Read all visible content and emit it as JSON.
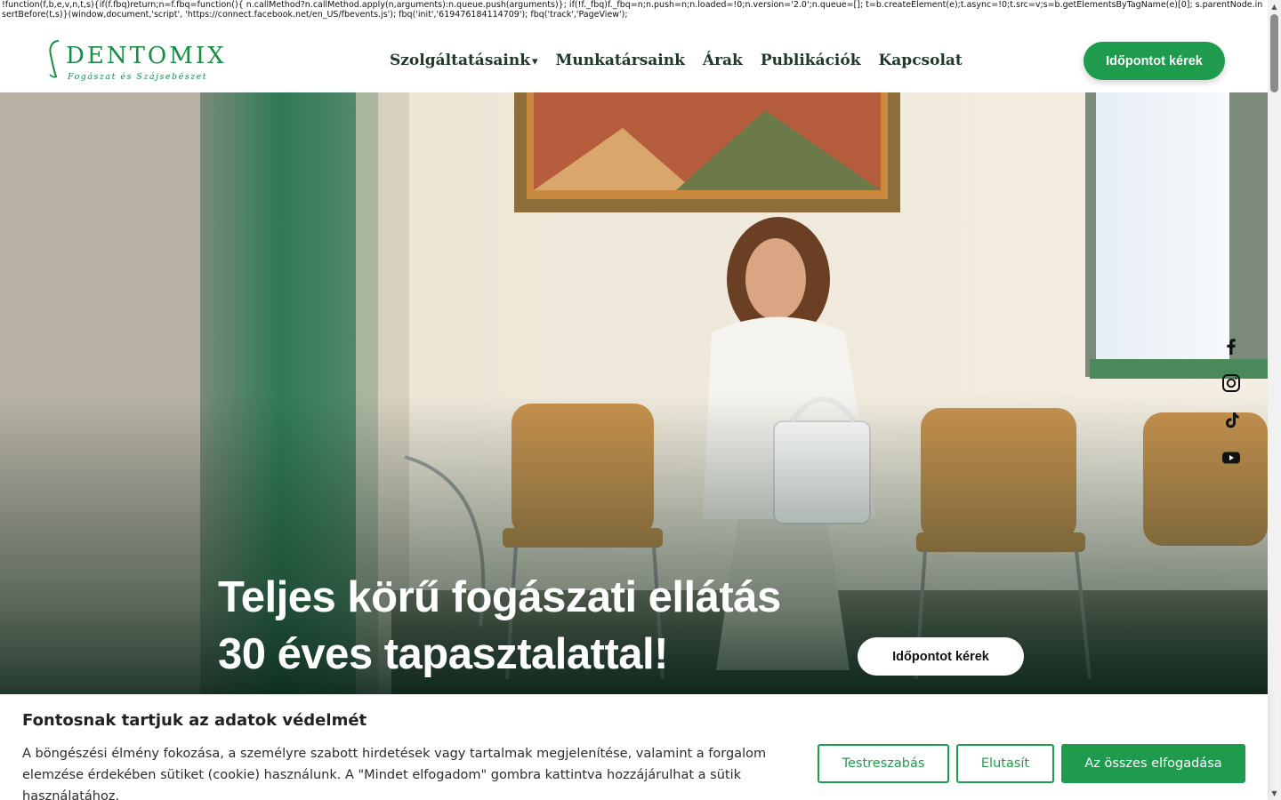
{
  "page_script_text": "!function(f,b,e,v,n,t,s){if(f.fbq)return;n=f.fbq=function(){ n.callMethod?n.callMethod.apply(n,arguments):n.queue.push(arguments)}; if(!f._fbq)f._fbq=n;n.push=n;n.loaded=!0;n.version='2.0';n.queue=[]; t=b.createElement(e);t.async=!0;t.src=v;s=b.getElementsByTagName(e)[0]; s.parentNode.insertBefore(t,s)}(window,document,'script', 'https://connect.facebook.net/en_US/fbevents.js'); fbq('init','619476184114709'); fbq('track','PageView');",
  "header": {
    "logo": {
      "name": "DENTOMIX",
      "tagline": "Fogászat és Szájsebészet"
    },
    "nav": [
      {
        "label": "Szolgáltatásaink",
        "caret": "▾"
      },
      {
        "label": "Munkatársaink"
      },
      {
        "label": "Árak"
      },
      {
        "label": "Publikációk"
      },
      {
        "label": "Kapcsolat"
      }
    ],
    "cta_label": "Időpontot kérek"
  },
  "hero": {
    "title_line1": "Teljes körű fogászati ellátás",
    "title_line2": "30 éves tapasztalattal!",
    "cta_label": "Időpontot kérek",
    "social_icons": [
      "facebook-icon",
      "instagram-icon",
      "tiktok-icon",
      "youtube-icon"
    ]
  },
  "cookie_banner": {
    "title": "Fontosnak tartjuk az adatok védelmét",
    "text": "A böngészési élmény fokozása, a személyre szabott hirdetések vagy tartalmak megjelenítése, valamint a forgalom elemzése érdekében sütiket (cookie) használunk. A \"Mindet elfogadom\" gombra kattintva hozzájárulhat a sütik használatához.",
    "customize_label": "Testreszabás",
    "reject_label": "Elutasít",
    "accept_label": "Az összes elfogadása"
  },
  "colors": {
    "brand_green": "#1f9b4e",
    "nav_text": "#20382a",
    "hero_overlay": "#0e281c"
  }
}
